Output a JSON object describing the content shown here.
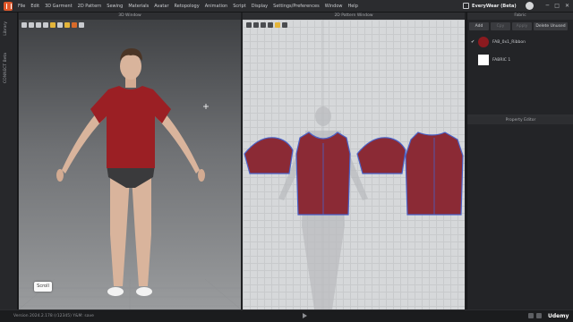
{
  "menubar": {
    "items": [
      "File",
      "Edit",
      "3D Garment",
      "2D Pattern",
      "Sewing",
      "Materials",
      "Avatar",
      "Retopology",
      "Animation",
      "Script",
      "Display",
      "Settings/Preferences",
      "Window",
      "Help"
    ],
    "brand": "EveryWear (Beta)"
  },
  "left_dock": {
    "tabs": [
      "Library",
      "CONNECT Beta"
    ]
  },
  "window_3d": {
    "title": "3D Window",
    "scroll_label": "Scroll",
    "toolbar_icons": [
      "pin-icon",
      "cube-icon",
      "magnet-icon",
      "sun-icon",
      "flag-icon",
      "lock-icon",
      "camera-icon",
      "color-icon",
      "globe-icon"
    ]
  },
  "window_2d": {
    "title": "2D Pattern Window",
    "toolbar_icons": [
      "select-icon",
      "transform-icon",
      "pen-icon",
      "copy-icon",
      "grid-icon",
      "lock-icon"
    ]
  },
  "fabric_panel": {
    "title": "Fabric",
    "buttons": [
      "Add",
      "Cpy",
      "Apply",
      "Delete Unused"
    ],
    "items": [
      {
        "name": "FAB_0x1_Ribbon",
        "color": "#8b1a1f",
        "checked": true
      },
      {
        "name": "FABRIC 1",
        "color": "#ffffff",
        "checked": false
      }
    ]
  },
  "property_editor": {
    "title": "Property Editor"
  },
  "statusbar": {
    "version": "Version 2024.2.178 (r12345)  Y&M: save",
    "watermark": "Udemy"
  },
  "colors": {
    "garment": "#8b2a35",
    "garment_outline": "#4a62c8",
    "menubar": "#2b2c2f",
    "viewport_top": "#3f4144"
  }
}
